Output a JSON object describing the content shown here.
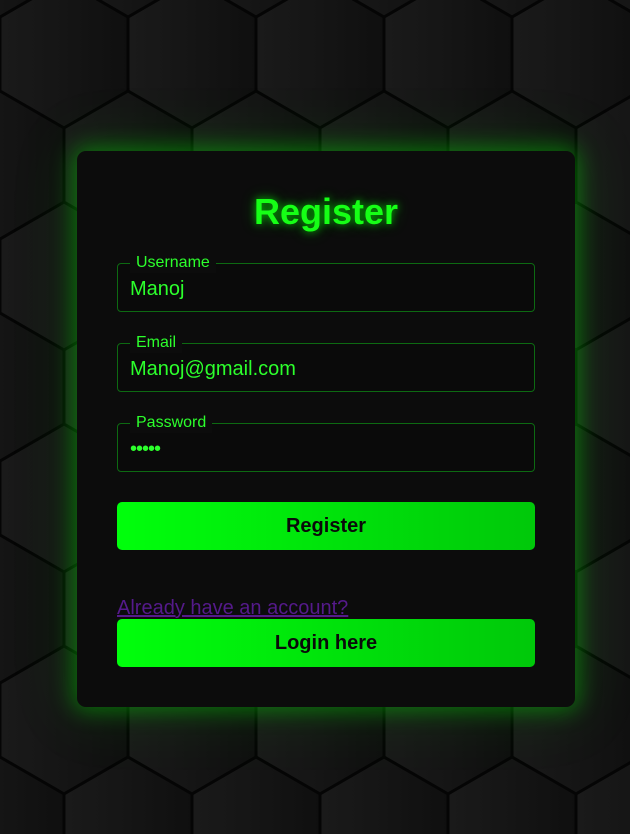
{
  "form": {
    "title": "Register",
    "username": {
      "label": "Username",
      "value": "Manoj"
    },
    "email": {
      "label": "Email",
      "value": "Manoj@gmail.com"
    },
    "password": {
      "label": "Password",
      "value": "12345"
    },
    "register_button": "Register",
    "account_prompt": "Already have an account?",
    "login_button": "Login here"
  },
  "colors": {
    "accent": "#16ff16",
    "button_gradient_start": "#00ff0c",
    "button_gradient_end": "#00c80a",
    "background": "#111111",
    "card": "#0c0c0c",
    "link": "#551a8b"
  }
}
